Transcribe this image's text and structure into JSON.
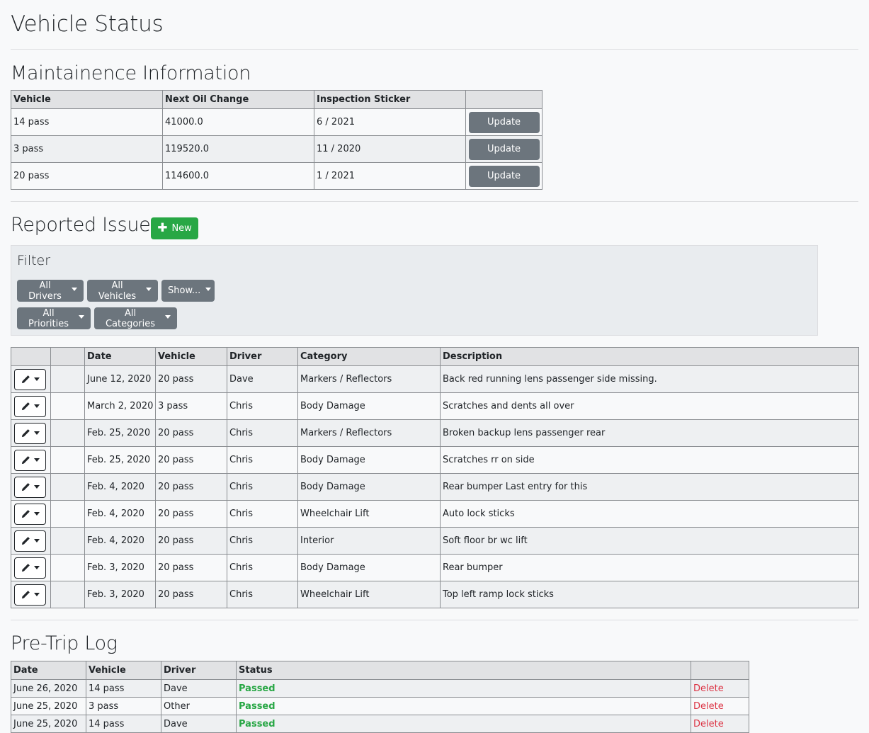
{
  "page_title": "Vehicle Status",
  "maintenance": {
    "heading": "Maintainence Information",
    "columns": [
      "Vehicle",
      "Next Oil Change",
      "Inspection Sticker",
      ""
    ],
    "update_label": "Update",
    "rows": [
      {
        "vehicle": "14 pass",
        "oil": "41000.0",
        "sticker": "6 / 2021"
      },
      {
        "vehicle": "3 pass",
        "oil": "119520.0",
        "sticker": "11 / 2020"
      },
      {
        "vehicle": "20 pass",
        "oil": "114600.0",
        "sticker": "1 / 2021"
      }
    ]
  },
  "issues": {
    "heading": "Reported Issues",
    "new_label": "New",
    "filter": {
      "title": "Filter",
      "drivers": "All Drivers",
      "vehicles": "All Vehicles",
      "show": "Show...",
      "priorities": "All Priorities",
      "categories": "All Categories"
    },
    "columns": [
      "",
      "",
      "Date",
      "Vehicle",
      "Driver",
      "Category",
      "Description"
    ],
    "rows": [
      {
        "date": "June 12, 2020",
        "vehicle": "20 pass",
        "driver": "Dave",
        "category": "Markers / Reflectors",
        "description": "Back red running lens passenger side missing."
      },
      {
        "date": "March 2, 2020",
        "vehicle": "3 pass",
        "driver": "Chris",
        "category": "Body Damage",
        "description": "Scratches and dents all over"
      },
      {
        "date": "Feb. 25, 2020",
        "vehicle": "20 pass",
        "driver": "Chris",
        "category": "Markers / Reflectors",
        "description": "Broken backup lens passenger rear"
      },
      {
        "date": "Feb. 25, 2020",
        "vehicle": "20 pass",
        "driver": "Chris",
        "category": "Body Damage",
        "description": "Scratches rr on side"
      },
      {
        "date": "Feb. 4, 2020",
        "vehicle": "20 pass",
        "driver": "Chris",
        "category": "Body Damage",
        "description": "Rear bumper Last entry for this"
      },
      {
        "date": "Feb. 4, 2020",
        "vehicle": "20 pass",
        "driver": "Chris",
        "category": "Wheelchair Lift",
        "description": "Auto lock sticks"
      },
      {
        "date": "Feb. 4, 2020",
        "vehicle": "20 pass",
        "driver": "Chris",
        "category": "Interior",
        "description": "Soft floor br wc lift"
      },
      {
        "date": "Feb. 3, 2020",
        "vehicle": "20 pass",
        "driver": "Chris",
        "category": "Body Damage",
        "description": "Rear bumper"
      },
      {
        "date": "Feb. 3, 2020",
        "vehicle": "20 pass",
        "driver": "Chris",
        "category": "Wheelchair Lift",
        "description": "Top left ramp lock sticks"
      }
    ]
  },
  "pretrip": {
    "heading": "Pre-Trip Log",
    "columns": [
      "Date",
      "Vehicle",
      "Driver",
      "Status",
      ""
    ],
    "delete_label": "Delete",
    "rows": [
      {
        "date": "June 26, 2020",
        "vehicle": "14 pass",
        "driver": "Dave",
        "status": "Passed"
      },
      {
        "date": "June 25, 2020",
        "vehicle": "3 pass",
        "driver": "Other",
        "status": "Passed"
      },
      {
        "date": "June 25, 2020",
        "vehicle": "14 pass",
        "driver": "Dave",
        "status": "Passed"
      }
    ]
  },
  "colors": {
    "success": "#28a745",
    "secondary": "#6c757d",
    "danger": "#dc3545"
  },
  "icons": {
    "new": "plus-icon",
    "edit": "pencil-icon",
    "dropdown": "caret-down-icon"
  }
}
